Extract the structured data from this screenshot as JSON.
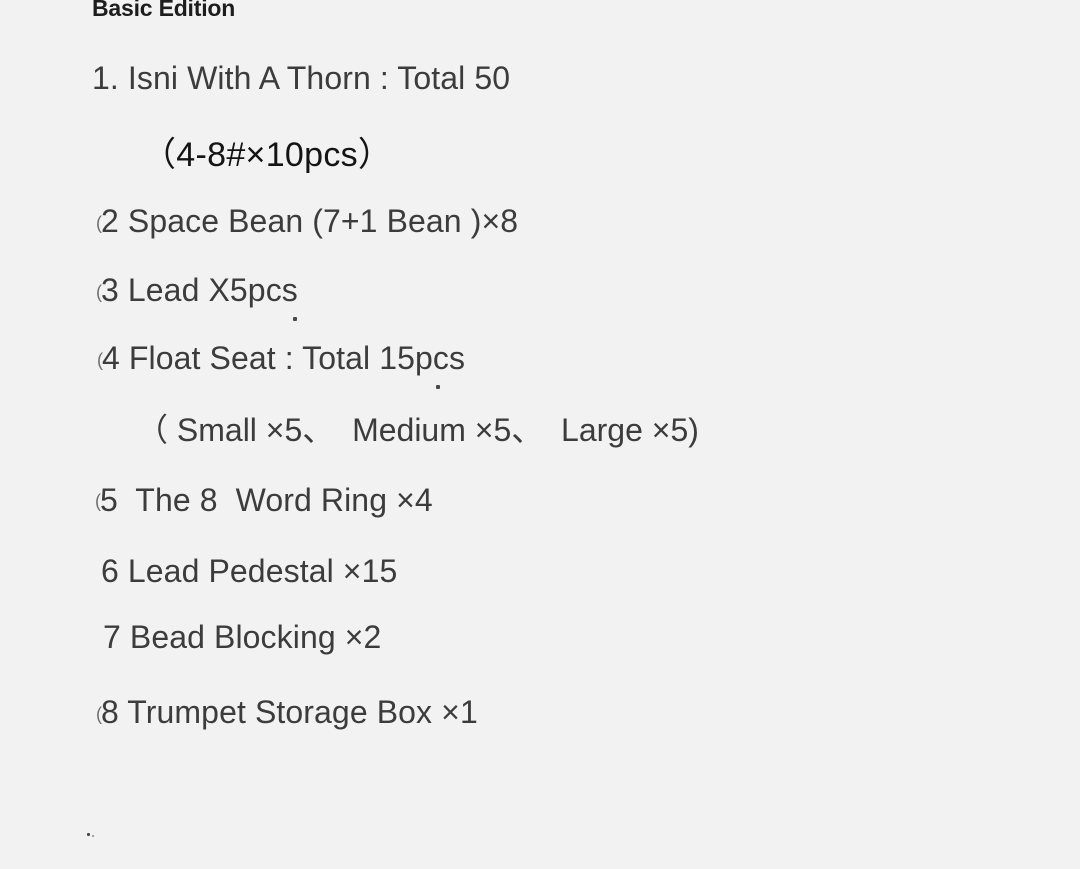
{
  "document": {
    "title": "Basic Edition",
    "background_color": "#f2f2f2",
    "text_color": "#3c3c3c",
    "title_color": "#1d1d1d",
    "emphasis_color": "#141414"
  },
  "items": [
    {
      "marker": "",
      "number": "1.",
      "text": "1. Isni With A Thorn : Total 50",
      "detail": "（4-8#×10pcs）"
    },
    {
      "marker": "(",
      "number": "2",
      "text": "2 Space Bean (7+1 Bean )×8",
      "detail": ""
    },
    {
      "marker": "(",
      "number": "3",
      "text": "3 Lead X5pcs",
      "detail": ""
    },
    {
      "marker": "(",
      "number": "4",
      "text": "4 Float Seat : Total 15pcs",
      "detail": "（ Small ×5、  Medium ×5、  Large ×5)"
    },
    {
      "marker": "(",
      "number": "5",
      "text": "5  The 8  Word Ring ×4",
      "detail": ""
    },
    {
      "marker": "",
      "number": "6",
      "text": "6 Lead Pedestal ×15",
      "detail": ""
    },
    {
      "marker": "",
      "number": "7",
      "text": "7 Bead Blocking ×2",
      "detail": ""
    },
    {
      "marker": "(",
      "number": "8",
      "text": "8 Trumpet Storage Box ×1",
      "detail": ""
    }
  ]
}
